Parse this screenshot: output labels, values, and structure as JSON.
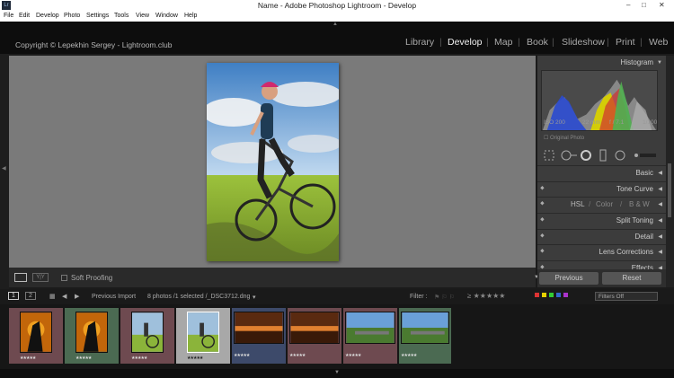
{
  "window": {
    "title": "Name - Adobe Photoshop Lightroom - Develop",
    "app_icon": "Lr",
    "minimize": "–",
    "maximize": "□",
    "close": "✕"
  },
  "menu": [
    "File",
    "Edit",
    "Develop",
    "Photo",
    "Settings",
    "Tools",
    "View",
    "Window",
    "Help"
  ],
  "identity": {
    "copyright": "Copyright © Lepekhin Sergey - Lightroom.club"
  },
  "modules": [
    "Library",
    "Develop",
    "Map",
    "Book",
    "Slideshow",
    "Print",
    "Web"
  ],
  "active_module": "Develop",
  "toolbar": {
    "soft_proofing": "Soft Proofing"
  },
  "panels": {
    "histogram": "Histogram",
    "hist_info": {
      "iso": "ISO 200",
      "focal": "22 mm",
      "aperture": "f / 7.1",
      "shutter": "1/100"
    },
    "original_photo": "Original Photo",
    "basic": "Basic",
    "tone_curve": "Tone Curve",
    "hsl": {
      "a": "HSL",
      "b": "Color",
      "c": "B & W"
    },
    "split_toning": "Split Toning",
    "detail": "Detail",
    "lens": "Lens Corrections",
    "effects": "Effects"
  },
  "buttons": {
    "previous": "Previous",
    "reset": "Reset"
  },
  "filmstrip": {
    "pg1": "1",
    "pg2": "2",
    "source": "Previous Import",
    "count": "8 photos /1 selected /_DSC3712.dng",
    "filter_label": "Filter :",
    "filters_off": "Filters Off"
  },
  "thumbs": [
    {
      "bg": "#6e4a50",
      "kind": "sunset"
    },
    {
      "bg": "#4b6a52",
      "kind": "sunset"
    },
    {
      "bg": "#6e4a50",
      "kind": "bike"
    },
    {
      "bg": "#9a9a9a",
      "kind": "bike"
    },
    {
      "bg": "#3d4a6a",
      "kind": "lake"
    },
    {
      "bg": "#6e4a50",
      "kind": "lake"
    },
    {
      "bg": "#6e4a50",
      "kind": "road"
    },
    {
      "bg": "#4b6a52",
      "kind": "road"
    }
  ],
  "stars": "★★★★★",
  "colors": {
    "accent_yellow": "#e8d000",
    "red_label": "#d33",
    "green_label": "#3c3",
    "blue_label": "#36c"
  }
}
